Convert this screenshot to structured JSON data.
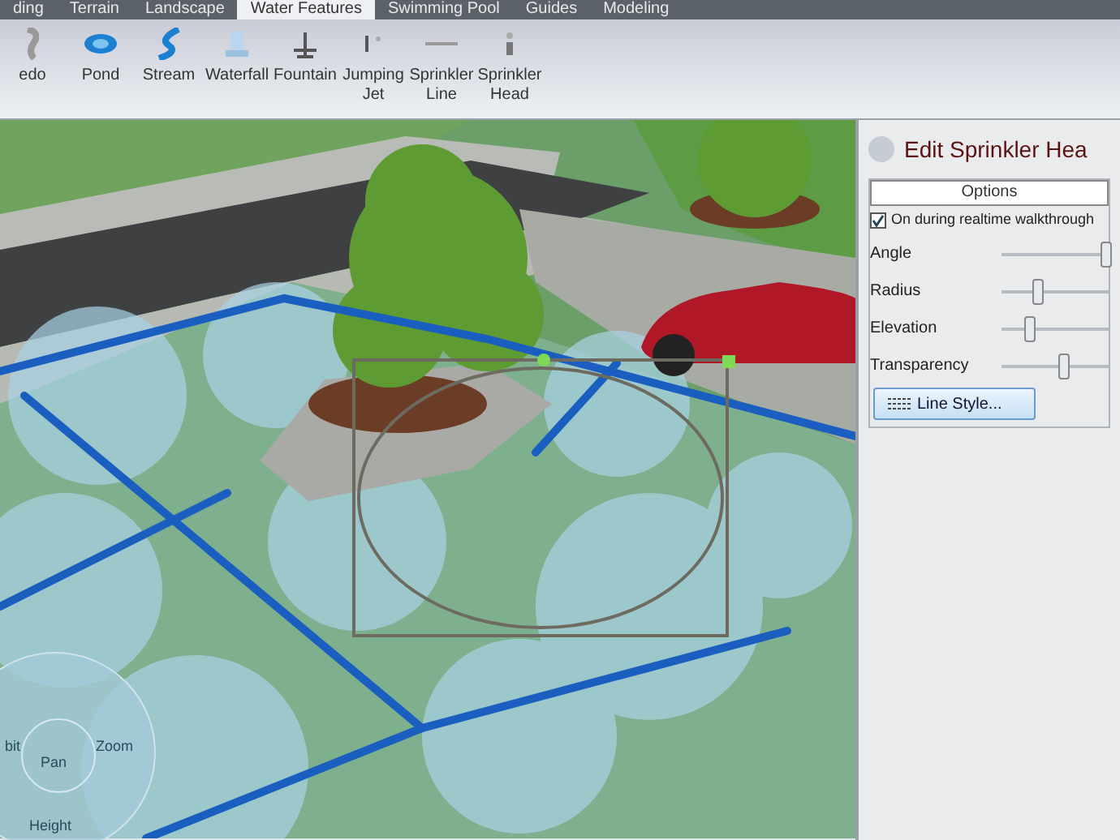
{
  "tabs": [
    {
      "label": "ding",
      "selected": false
    },
    {
      "label": "Terrain",
      "selected": false
    },
    {
      "label": "Landscape",
      "selected": false
    },
    {
      "label": "Water Features",
      "selected": true
    },
    {
      "label": "Swimming Pool",
      "selected": false
    },
    {
      "label": "Guides",
      "selected": false
    },
    {
      "label": "Modeling",
      "selected": false
    }
  ],
  "tools": [
    {
      "label": "edo",
      "kind": "tornado"
    },
    {
      "label": "Pond",
      "kind": "pond"
    },
    {
      "label": "Stream",
      "kind": "stream"
    },
    {
      "label": "Waterfall",
      "kind": "waterfall"
    },
    {
      "label": "Fountain",
      "kind": "fountain"
    },
    {
      "label": "Jumping Jet",
      "kind": "jet"
    },
    {
      "label": "Sprinkler Line",
      "kind": "line"
    },
    {
      "label": "Sprinkler Head",
      "kind": "head"
    }
  ],
  "nav_wheel": {
    "orbit": "bit",
    "pan": "Pan",
    "zoom": "Zoom",
    "height": "Height"
  },
  "panel": {
    "title": "Edit Sprinkler Hea",
    "section": "Options",
    "checkbox": {
      "label": "On during realtime walkthrough",
      "checked": true
    },
    "sliders": [
      {
        "label": "Angle",
        "level": 0.97
      },
      {
        "label": "Radius",
        "level": 0.3
      },
      {
        "label": "Elevation",
        "level": 0.22
      },
      {
        "label": "Transparency",
        "level": 0.55
      }
    ],
    "button": "Line Style..."
  }
}
